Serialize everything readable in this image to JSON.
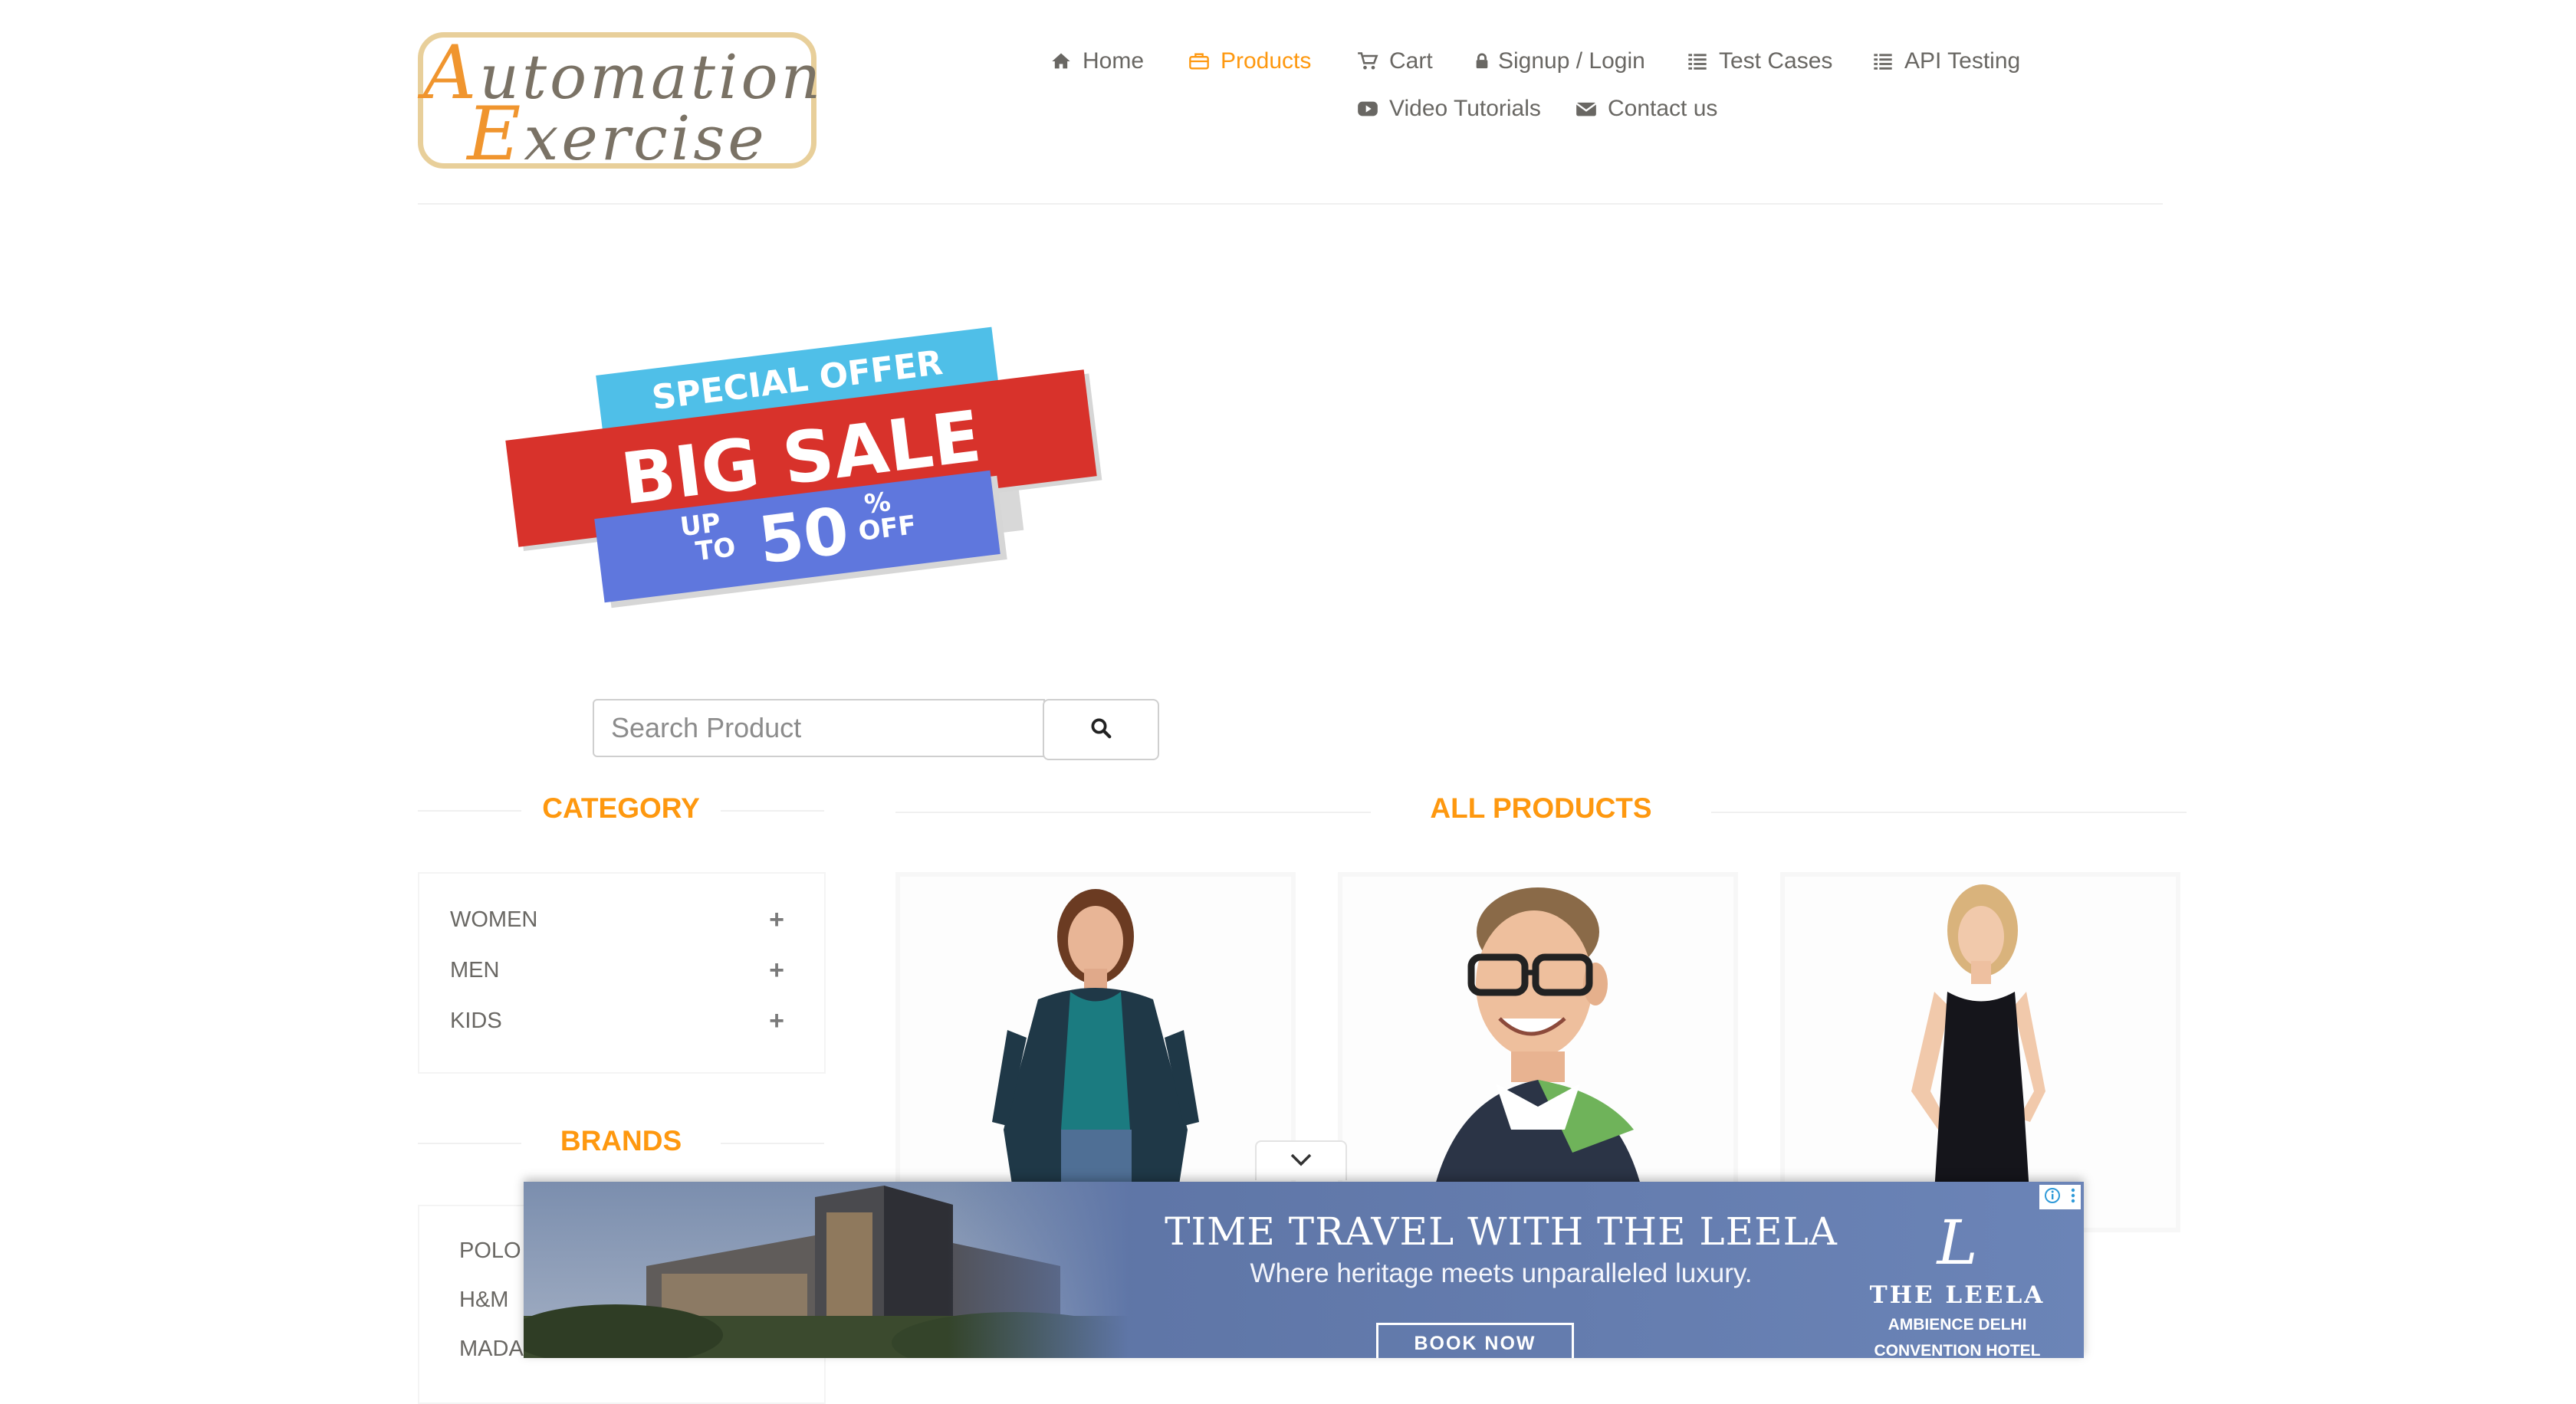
{
  "logo": {
    "line1_first": "A",
    "line1_rest": "utomation",
    "line2_first": "E",
    "line2_rest": "xercise"
  },
  "nav": {
    "items": [
      {
        "label": "Home",
        "icon": "home-icon"
      },
      {
        "label": "Products",
        "icon": "briefcase-icon",
        "active": true
      },
      {
        "label": "Cart",
        "icon": "cart-icon"
      },
      {
        "label": "Signup / Login",
        "icon": "lock-icon"
      },
      {
        "label": "Test Cases",
        "icon": "list-icon"
      },
      {
        "label": "API Testing",
        "icon": "list-icon"
      },
      {
        "label": "Video Tutorials",
        "icon": "youtube-play-icon"
      },
      {
        "label": "Contact us",
        "icon": "envelope-icon"
      }
    ],
    "active_color": "#fe980f"
  },
  "banner": {
    "line1": "SPECIAL OFFER",
    "line2": "BIG SALE",
    "up": "UP",
    "to": "TO",
    "percent": "50",
    "pct_sign": "%",
    "off": "OFF"
  },
  "search": {
    "placeholder": "Search Product",
    "value": "",
    "button_icon": "search-icon"
  },
  "sidebar": {
    "category_title": "CATEGORY",
    "categories": [
      {
        "label": "WOMEN",
        "icon": "plus-icon"
      },
      {
        "label": "MEN",
        "icon": "plus-icon"
      },
      {
        "label": "KIDS",
        "icon": "plus-icon"
      }
    ],
    "brands_title": "BRANDS",
    "brands": [
      {
        "label": "POLO"
      },
      {
        "label": "H&M"
      },
      {
        "label": "MADA"
      }
    ]
  },
  "main": {
    "title": "ALL PRODUCTS"
  },
  "ad": {
    "title": "TIME TRAVEL WITH THE LEELA",
    "subtitle": "Where heritage meets unparalleled luxury.",
    "button": "BOOK NOW",
    "brand_logo": "L",
    "brand_name": "THE LEELA",
    "brand_sub1": "AMBIENCE DELHI",
    "brand_sub2": "CONVENTION HOTEL",
    "collapse_icon": "chevron-down-icon",
    "info_icon": "info-icon",
    "menu_icon": "kebab-menu-icon"
  },
  "colors": {
    "accent": "#fe980f",
    "text": "#696763",
    "banner_blue": "#4fbfe8",
    "banner_red": "#d8322b",
    "banner_purple": "#5f77dd"
  }
}
